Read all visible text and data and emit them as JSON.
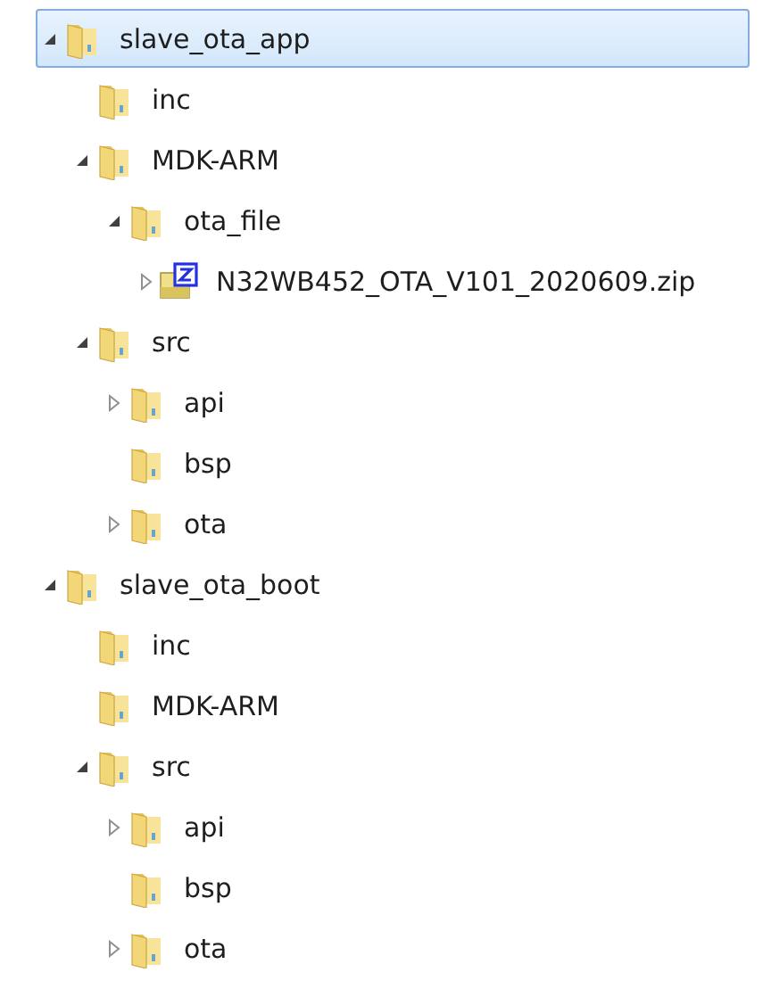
{
  "tree": [
    {
      "label": "slave_ota_app",
      "kind": "folder",
      "expanded": true,
      "selected": true,
      "children": [
        {
          "label": "inc",
          "kind": "folder",
          "selected": false
        },
        {
          "label": "MDK-ARM",
          "kind": "folder",
          "expanded": true,
          "selected": false,
          "children": [
            {
              "label": "ota_file",
              "kind": "folder",
              "expanded": true,
              "selected": false,
              "children": [
                {
                  "label": "N32WB452_OTA_V101_2020609.zip",
                  "kind": "zip",
                  "expanded": false,
                  "selected": false
                }
              ]
            }
          ]
        },
        {
          "label": "src",
          "kind": "folder",
          "expanded": true,
          "selected": false,
          "children": [
            {
              "label": "api",
              "kind": "folder",
              "expanded": false,
              "selected": false
            },
            {
              "label": "bsp",
              "kind": "folder",
              "selected": false
            },
            {
              "label": "ota",
              "kind": "folder",
              "expanded": false,
              "selected": false
            }
          ]
        }
      ]
    },
    {
      "label": "slave_ota_boot",
      "kind": "folder",
      "expanded": true,
      "selected": false,
      "children": [
        {
          "label": "inc",
          "kind": "folder",
          "selected": false
        },
        {
          "label": "MDK-ARM",
          "kind": "folder",
          "selected": false
        },
        {
          "label": "src",
          "kind": "folder",
          "expanded": true,
          "selected": false,
          "children": [
            {
              "label": "api",
              "kind": "folder",
              "expanded": false,
              "selected": false
            },
            {
              "label": "bsp",
              "kind": "folder",
              "selected": false
            },
            {
              "label": "ota",
              "kind": "folder",
              "expanded": false,
              "selected": false
            }
          ]
        }
      ]
    }
  ]
}
